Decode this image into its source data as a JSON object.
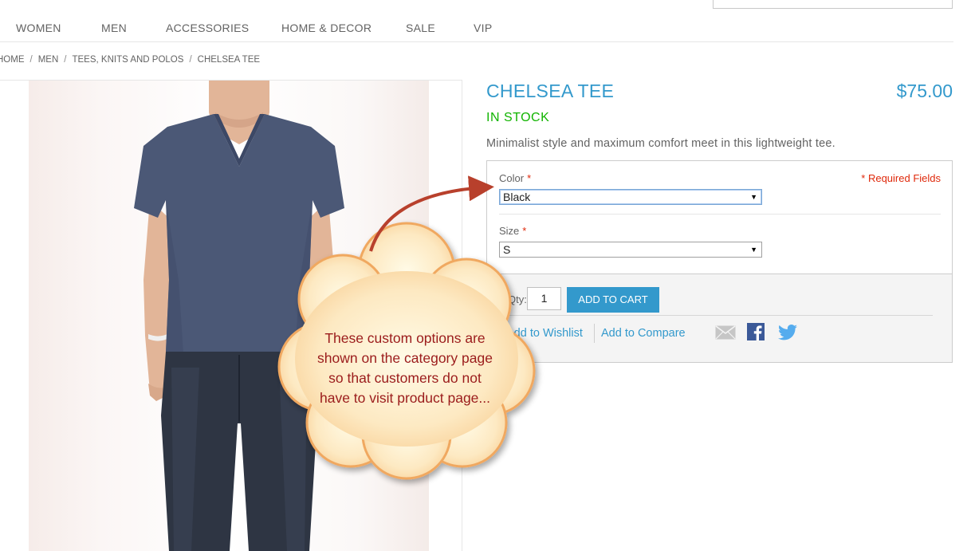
{
  "nav": {
    "items": [
      {
        "label": "WOMEN"
      },
      {
        "label": "MEN"
      },
      {
        "label": "ACCESSORIES"
      },
      {
        "label": "HOME & DECOR"
      },
      {
        "label": "SALE"
      },
      {
        "label": "VIP"
      }
    ]
  },
  "breadcrumb": {
    "items": [
      "HOME",
      "MEN",
      "TEES, KNITS AND POLOS"
    ],
    "current": "CHELSEA TEE",
    "separator": "/"
  },
  "product": {
    "name": "CHELSEA TEE",
    "price": "$75.00",
    "availability": "IN STOCK",
    "short_description": "Minimalist style and maximum comfort meet in this lightweight tee.",
    "image_icon": "product-photo-man-in-navy-tee-icon"
  },
  "options": {
    "required_note": "* Required Fields",
    "required_mark": "*",
    "color": {
      "label": "Color",
      "selected": "Black"
    },
    "size": {
      "label": "Size",
      "selected": "S"
    }
  },
  "cart": {
    "qty_label": "Qty:",
    "qty_value": "1",
    "add_button": "Add to Cart",
    "wishlist_link": "Add to Wishlist",
    "compare_link": "Add to Compare",
    "share_icons": [
      "email-icon",
      "facebook-icon",
      "twitter-icon"
    ]
  },
  "callout": {
    "lines": [
      "These custom options are",
      "shown on the category page",
      "so that customers do not",
      "have to visit product page..."
    ]
  },
  "colors": {
    "accent": "#3399cc",
    "in_stock": "#11b400",
    "required": "#df280a",
    "callout_text": "#9b1c1c",
    "callout_fill": "#fde3b2",
    "arrow": "#b8402c"
  }
}
